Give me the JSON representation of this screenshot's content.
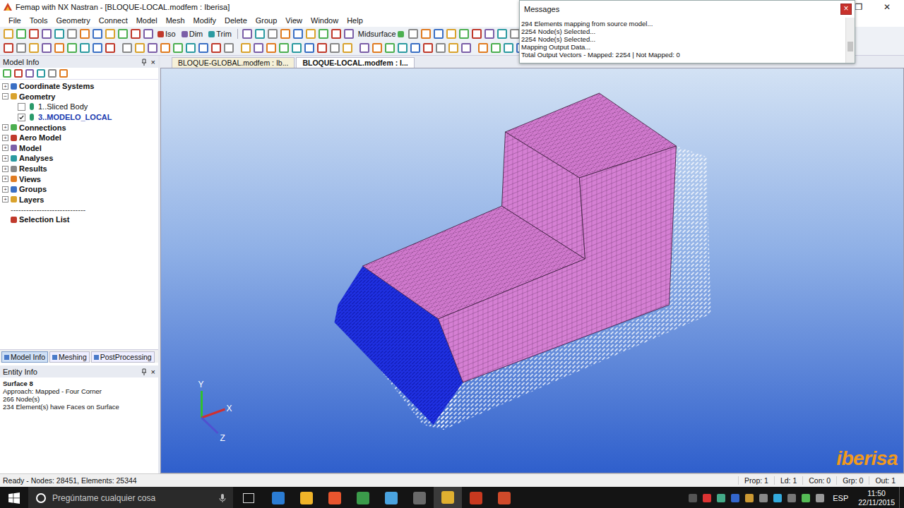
{
  "window": {
    "title": "Femap with NX Nastran - [BLOQUE-LOCAL.modfem : Iberisa]",
    "controls": [
      "❐",
      "✕"
    ]
  },
  "menu": [
    "File",
    "Tools",
    "Geometry",
    "Connect",
    "Model",
    "Mesh",
    "Modify",
    "Delete",
    "Group",
    "View",
    "Window",
    "Help"
  ],
  "toolbar_buttons": [
    "Iso",
    "Dim",
    "Trim",
    "Midsurface",
    "Custom Tool"
  ],
  "messages": {
    "title": "Messages",
    "close": "×",
    "lines": [
      "294 Elements mapping from source model...",
      "2254 Node(s) Selected...",
      "2254 Node(s) Selected...",
      "Mapping Output Data...",
      "Total Output Vectors - Mapped: 2254 | Not Mapped: 0"
    ]
  },
  "model_info": {
    "title": "Model Info",
    "close": "×",
    "items": [
      {
        "kind": "node",
        "label": "Coordinate Systems",
        "toggle": "+",
        "expanded": false,
        "children": []
      },
      {
        "kind": "node",
        "label": "Geometry",
        "toggle": "−",
        "expanded": true,
        "children": [
          {
            "label": "1..Sliced Body",
            "checked": false,
            "active": false
          },
          {
            "label": "3..MODELO_LOCAL",
            "checked": true,
            "active": true
          }
        ]
      },
      {
        "kind": "node",
        "label": "Connections",
        "toggle": "+",
        "expanded": false,
        "children": []
      },
      {
        "kind": "node",
        "label": "Aero Model",
        "toggle": "+",
        "expanded": false,
        "children": []
      },
      {
        "kind": "node",
        "label": "Model",
        "toggle": "+",
        "expanded": false,
        "children": []
      },
      {
        "kind": "node",
        "label": "Analyses",
        "toggle": "+",
        "expanded": false,
        "children": []
      },
      {
        "kind": "node",
        "label": "Results",
        "toggle": "+",
        "expanded": false,
        "children": []
      },
      {
        "kind": "node",
        "label": "Views",
        "toggle": "+",
        "expanded": false,
        "children": []
      },
      {
        "kind": "node",
        "label": "Groups",
        "toggle": "+",
        "expanded": false,
        "children": []
      },
      {
        "kind": "node",
        "label": "Layers",
        "toggle": "+",
        "expanded": false,
        "children": []
      },
      {
        "kind": "separator",
        "label": "-----------------------------",
        "toggle": "",
        "expanded": false,
        "children": []
      },
      {
        "kind": "leaf",
        "label": "Selection List",
        "toggle": "",
        "expanded": false,
        "children": []
      }
    ]
  },
  "panel_tabs": [
    {
      "label": "Model Info",
      "selected": true
    },
    {
      "label": "Meshing",
      "selected": false
    },
    {
      "label": "PostProcessing",
      "selected": false
    }
  ],
  "entity_info": {
    "title": "Entity Info",
    "close": "×",
    "lines": [
      "Surface 8",
      "Approach: Mapped - Four Corner",
      "266 Node(s)",
      "234 Element(s) have Faces on Surface"
    ]
  },
  "doc_tabs": [
    {
      "label": "BLOQUE-GLOBAL.modfem : Ib...",
      "selected": false
    },
    {
      "label": "BLOQUE-LOCAL.modfem : I...",
      "selected": true
    }
  ],
  "viewport": {
    "axes": [
      "X",
      "Y",
      "Z"
    ],
    "logo": "iberisa"
  },
  "status_bar": {
    "left": "Ready - Nodes: 28451, Elements: 25344",
    "fields": [
      "Prop: 1",
      "Ld: 1",
      "Con: 0",
      "Grp: 0",
      "Out: 1"
    ]
  },
  "taskbar": {
    "search": "Pregúntame cualquier cosa",
    "language": "ESP",
    "time": "11:50",
    "date": "22/11/2015"
  }
}
